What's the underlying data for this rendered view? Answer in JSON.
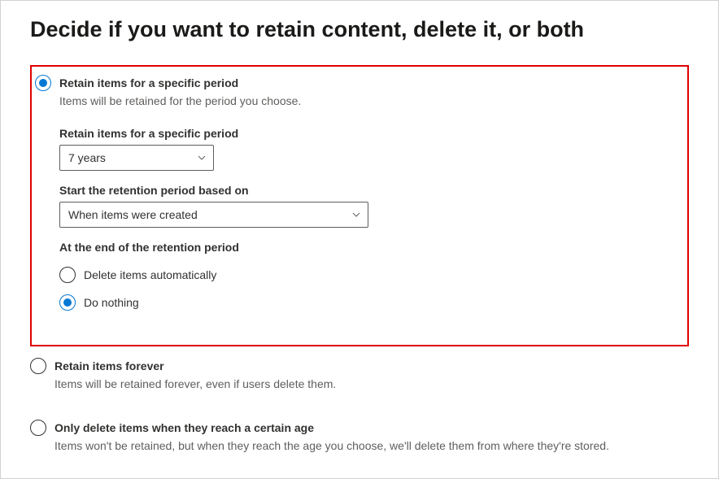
{
  "title": "Decide if you want to retain content, delete it, or both",
  "options": {
    "retain_specific": {
      "label": "Retain items for a specific period",
      "desc": "Items will be retained for the period you choose.",
      "selected": true,
      "fields": {
        "period_label": "Retain items for a specific period",
        "period_value": "7 years",
        "start_label": "Start the retention period based on",
        "start_value": "When items were created",
        "end_label": "At the end of the retention period",
        "end_choices": {
          "delete_auto": {
            "label": "Delete items automatically",
            "selected": false
          },
          "do_nothing": {
            "label": "Do nothing",
            "selected": true
          }
        }
      }
    },
    "retain_forever": {
      "label": "Retain items forever",
      "desc": "Items will be retained forever, even if users delete them.",
      "selected": false
    },
    "only_delete": {
      "label": "Only delete items when they reach a certain age",
      "desc": "Items won't be retained, but when they reach the age you choose, we'll delete them from where they're stored.",
      "selected": false
    }
  }
}
